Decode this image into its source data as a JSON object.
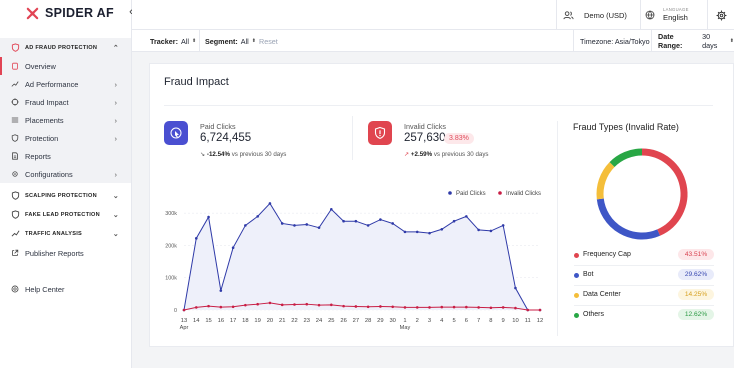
{
  "brand": {
    "name": "SPIDER AF",
    "accent": "#e14454"
  },
  "sidebar": {
    "collapse_icon": "chevron-left-icon",
    "ad_fraud_section": "AD FRAUD PROTECTION",
    "items": [
      {
        "label": "Overview",
        "icon": "clipboard-icon",
        "active": true
      },
      {
        "label": "Ad Performance",
        "icon": "trend-icon"
      },
      {
        "label": "Fraud Impact",
        "icon": "target-icon"
      },
      {
        "label": "Placements",
        "icon": "list-icon"
      },
      {
        "label": "Protection",
        "icon": "shield-icon"
      },
      {
        "label": "Reports",
        "icon": "document-icon"
      },
      {
        "label": "Configurations",
        "icon": "gear-icon"
      }
    ],
    "scalping_section": "SCALPING PROTECTION",
    "fake_lead_section": "FAKE LEAD PROTECTION",
    "traffic_section": "TRAFFIC ANALYSIS",
    "publisher_reports": "Publisher Reports",
    "help_center": "Help Center"
  },
  "topbar": {
    "account": "Demo (USD)",
    "language_label": "LANGUAGE",
    "language": "English"
  },
  "filters": {
    "tracker_label": "Tracker:",
    "tracker_value": "All",
    "segment_label": "Segment:",
    "segment_value": "All",
    "reset": "Reset",
    "timezone": "Timezone: Asia/Tokyo",
    "date_range_label": "Date Range:",
    "date_range_value": "30 days"
  },
  "fraud_impact": {
    "title": "Fraud Impact",
    "paid": {
      "label": "Paid Clicks",
      "value": "6,724,455",
      "change": "-12.54%",
      "change_suffix": "vs previous 30 days"
    },
    "invalid": {
      "label": "Invalid Clicks",
      "value": "257,630",
      "rate": "3.83%",
      "change": "+2.59%",
      "change_suffix": "vs previous 30 days"
    }
  },
  "chart_data": {
    "type": "line",
    "x": [
      "13",
      "14",
      "15",
      "16",
      "17",
      "18",
      "19",
      "20",
      "21",
      "22",
      "23",
      "24",
      "25",
      "26",
      "27",
      "28",
      "29",
      "30",
      "1",
      "2",
      "3",
      "4",
      "5",
      "6",
      "7",
      "8",
      "9",
      "10",
      "11",
      "12"
    ],
    "x_month_labels": [
      {
        "index": 0,
        "label": "Apr"
      },
      {
        "index": 18,
        "label": "May"
      }
    ],
    "series": [
      {
        "name": "Paid Clicks",
        "color": "#2f3aa8",
        "values": [
          0,
          222000,
          288000,
          60000,
          193000,
          262000,
          290000,
          330000,
          268000,
          262000,
          265000,
          255000,
          312000,
          275000,
          275000,
          262000,
          280000,
          268000,
          242000,
          242000,
          238000,
          250000,
          275000,
          290000,
          248000,
          245000,
          262000,
          68000,
          0,
          0
        ]
      },
      {
        "name": "Invalid Clicks",
        "color": "#c81e45",
        "values": [
          0,
          8000,
          12000,
          9000,
          10000,
          15000,
          18000,
          22000,
          16000,
          17000,
          18000,
          15000,
          16000,
          12000,
          11000,
          10000,
          11000,
          10000,
          8000,
          8000,
          8000,
          9000,
          9000,
          9000,
          8000,
          7000,
          8000,
          6000,
          0,
          0
        ]
      }
    ],
    "y_ticks": [
      "0",
      "100k",
      "200k",
      "300k"
    ],
    "ylim": [
      0,
      350000
    ],
    "grid": true,
    "legend": "top-right"
  },
  "fraud_types": {
    "title": "Fraud Types (Invalid Rate)",
    "items": [
      {
        "name": "Frequency Cap",
        "pct": "43.51%",
        "value": 43.51,
        "color": "#e0454f",
        "pill_bg": "#fde7e9",
        "pill_fg": "#d94452"
      },
      {
        "name": "Bot",
        "pct": "29.62%",
        "value": 29.62,
        "color": "#3e56c6",
        "pill_bg": "#e8ebfa",
        "pill_fg": "#3848b0"
      },
      {
        "name": "Data Center",
        "pct": "14.25%",
        "value": 14.25,
        "color": "#f4be3a",
        "pill_bg": "#fdf5df",
        "pill_fg": "#d6a020"
      },
      {
        "name": "Others",
        "pct": "12.62%",
        "value": 12.62,
        "color": "#28a745",
        "pill_bg": "#e4f5e7",
        "pill_fg": "#2d9a45"
      }
    ]
  }
}
